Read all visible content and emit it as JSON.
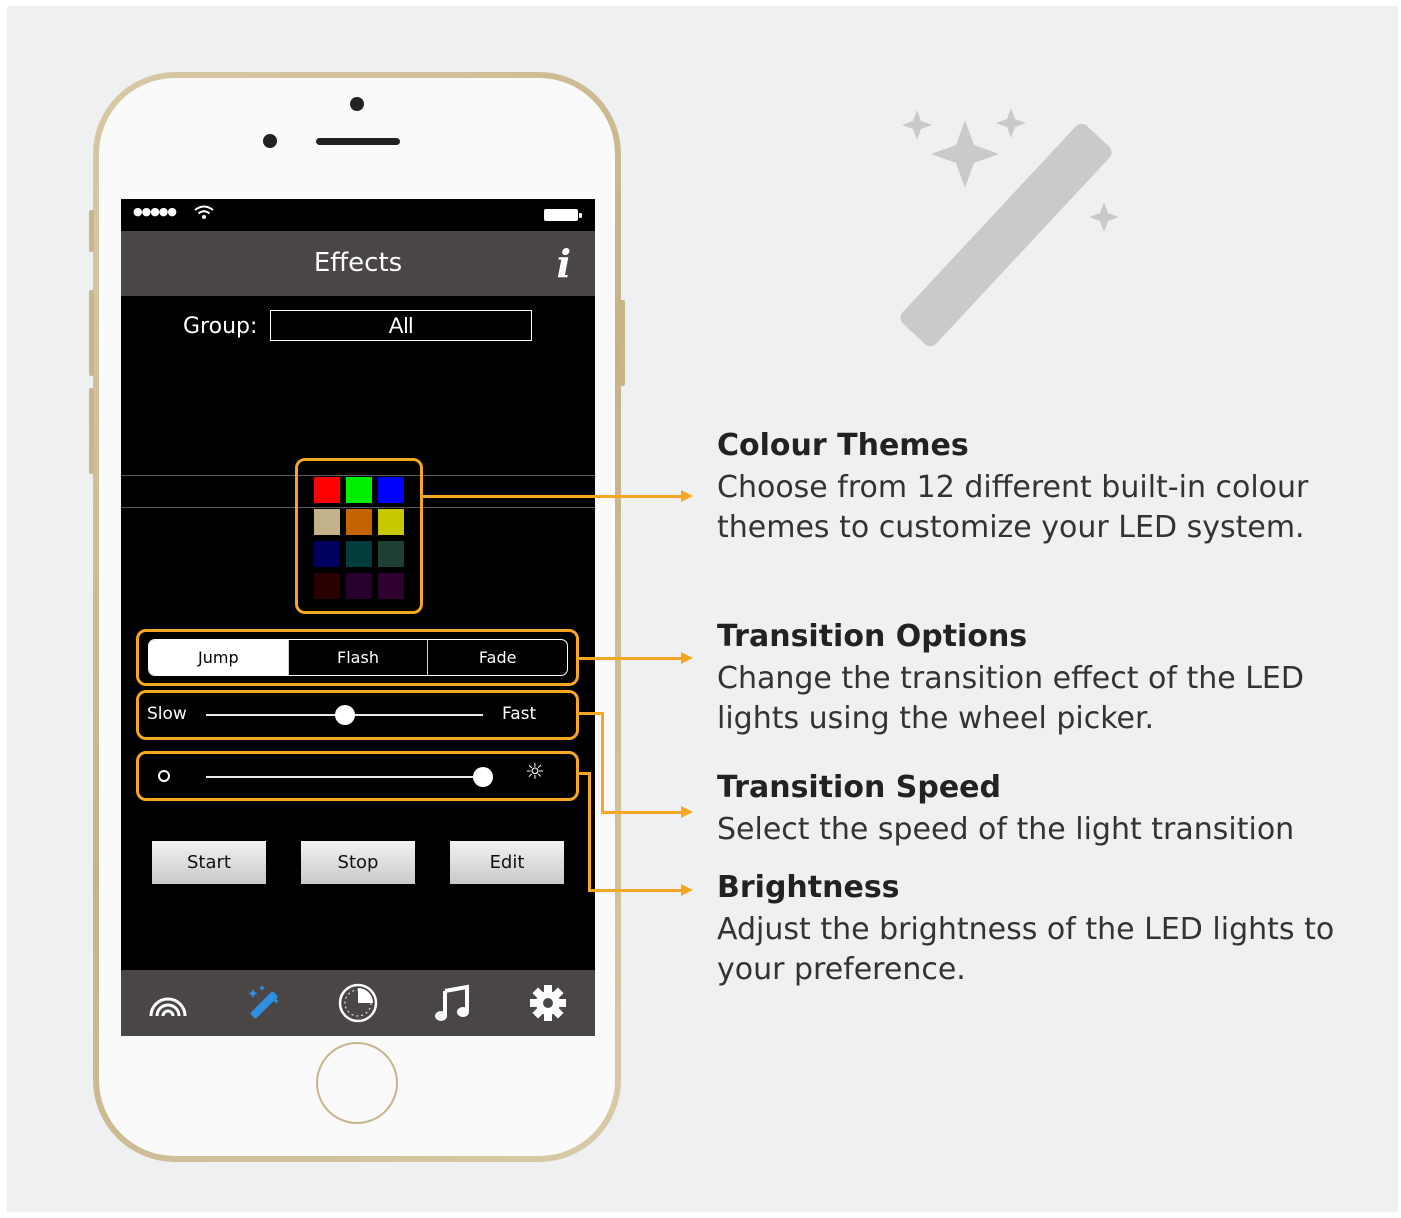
{
  "screen": {
    "title": "Effects",
    "info_button": "i",
    "group": {
      "label": "Group:",
      "value": "All"
    },
    "colour_swatches": [
      "#ff0000",
      "#00ee00",
      "#0000ff",
      "#c4b38a",
      "#c46400",
      "#c8c800",
      "#000060",
      "#003c3c",
      "#1e4032",
      "#2a0000",
      "#28002c",
      "#30002e"
    ],
    "transitions": [
      {
        "label": "Jump",
        "active": true
      },
      {
        "label": "Flash",
        "active": false
      },
      {
        "label": "Fade",
        "active": false
      }
    ],
    "speed": {
      "min_label": "Slow",
      "max_label": "Fast",
      "value": 0.5
    },
    "brightness": {
      "value": 1.0
    },
    "buttons": {
      "start": "Start",
      "stop": "Stop",
      "edit": "Edit"
    },
    "tabs": [
      {
        "icon": "rainbow-icon",
        "active": false
      },
      {
        "icon": "magic-wand-icon",
        "active": true
      },
      {
        "icon": "timer-icon",
        "active": false
      },
      {
        "icon": "music-note-icon",
        "active": false
      },
      {
        "icon": "gear-icon",
        "active": false
      }
    ],
    "accent_color": "#f5a623",
    "active_tab_color": "#2f8fe0"
  },
  "callouts": {
    "colour_themes": {
      "title": "Colour Themes",
      "line1": "Choose from 12 different built-in colour",
      "line2": "themes to customize your LED system."
    },
    "transition_options": {
      "title": "Transition Options",
      "line1": "Change the transition effect of the LED",
      "line2": "lights using the wheel picker."
    },
    "transition_speed": {
      "title": "Transition Speed",
      "line1": "Select the speed of the light transition"
    },
    "brightness": {
      "title": "Brightness",
      "line1": "Adjust the brightness of the LED lights to",
      "line2": "your preference."
    }
  }
}
